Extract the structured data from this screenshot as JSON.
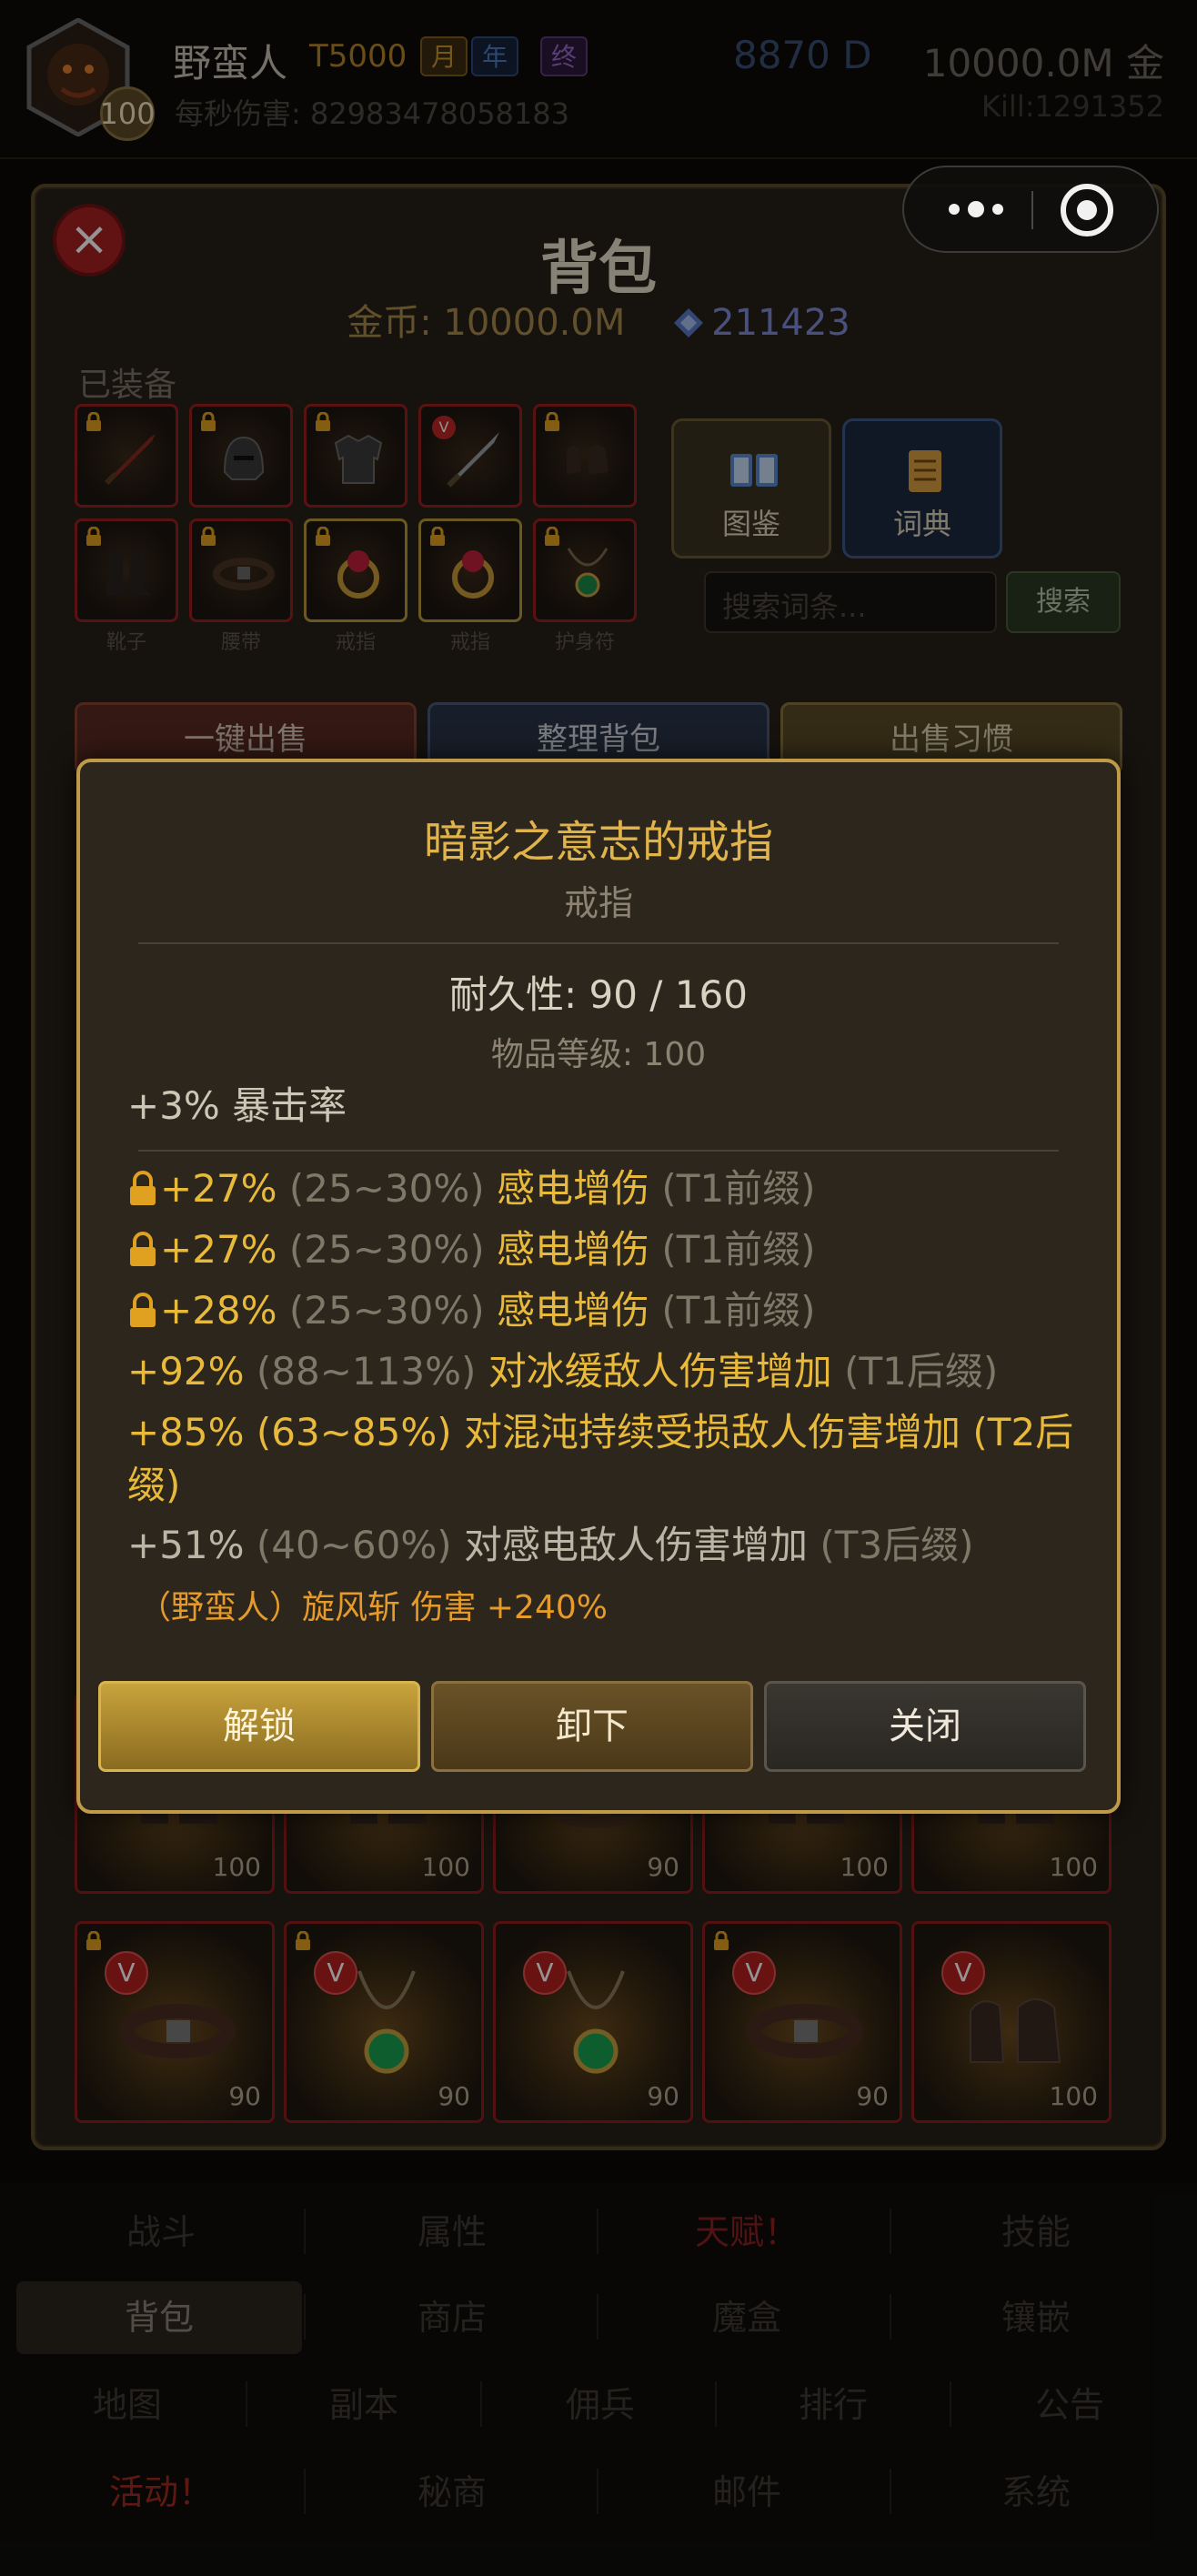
{
  "header": {
    "avatar_level": "100",
    "player_name": "野蛮人",
    "tier": "T5000",
    "badges": [
      "月",
      "年",
      "终"
    ],
    "dps_label": "每秒伤害: 82983478058183",
    "diamond": "8870 D",
    "gold": "10000.0M 金",
    "kills": "Kill:1291352"
  },
  "bag": {
    "title": "背包",
    "gold_text": "金币: 10000.0M",
    "gem_text": "211423",
    "equipped_label": "已装备",
    "equipped_captions": [
      "靴子",
      "腰带",
      "戒指",
      "戒指",
      "护身符"
    ],
    "codex_label": "图鉴",
    "dictionary_label": "词典",
    "search_placeholder": "搜索词条...",
    "search_button": "搜索",
    "actions": [
      "一键出售",
      "整理背包",
      "出售习惯"
    ]
  },
  "inventory": {
    "row1_levels": [
      "100",
      "100",
      "90",
      "100",
      "100"
    ],
    "row2": [
      {
        "item": "belt",
        "level": "90",
        "locked": true,
        "v": "V"
      },
      {
        "item": "amulet",
        "level": "90",
        "locked": true,
        "v": "V"
      },
      {
        "item": "amulet",
        "level": "90",
        "locked": false,
        "v": "V"
      },
      {
        "item": "belt",
        "level": "90",
        "locked": true,
        "v": "V"
      },
      {
        "item": "gloves",
        "level": "100",
        "locked": false,
        "v": "V"
      }
    ]
  },
  "modal": {
    "title": "暗影之意志的戒指",
    "type": "戒指",
    "durability": "耐久性: 90 / 160",
    "item_level": "物品等级: 100",
    "implicit": "+3% 暴击率",
    "affixes": [
      {
        "locked": true,
        "value": "+27%",
        "range": "(25~30%)",
        "name": "感电增伤",
        "tier": "(T1前缀)"
      },
      {
        "locked": true,
        "value": "+27%",
        "range": "(25~30%)",
        "name": "感电增伤",
        "tier": "(T1前缀)"
      },
      {
        "locked": true,
        "value": "+28%",
        "range": "(25~30%)",
        "name": "感电增伤",
        "tier": "(T1前缀)"
      },
      {
        "locked": false,
        "value": "+92%",
        "range": "(88~113%)",
        "name": "对冰缓敌人伤害增加",
        "tier": "(T1后缀)"
      },
      {
        "locked": false,
        "value": "+85%",
        "range": "(63~85%)",
        "name": "对混沌持续受损敌人伤害增加",
        "tier": "(T2后缀)"
      },
      {
        "locked": false,
        "value": "+51%",
        "range": "(40~60%)",
        "name": "对感电敌人伤害增加",
        "tier": "(T3后缀)"
      }
    ],
    "skill_bonus": "（野蛮人）旋风斩 伤害 +240%",
    "buttons": {
      "unlock": "解锁",
      "unequip": "卸下",
      "close": "关闭"
    }
  },
  "bottom_nav": [
    [
      "战斗",
      "属性",
      "天赋！",
      "技能"
    ],
    [
      "背包",
      "商店",
      "魔盒",
      "镶嵌"
    ],
    [
      "地图",
      "副本",
      "佣兵",
      "排行",
      "公告"
    ],
    [
      "活动！",
      "秘商",
      "邮件",
      "系统"
    ]
  ],
  "colors": {
    "modal_border": "#bf9a48",
    "title_gold": "#e0b44a",
    "affix_gold": "#e9ba3a",
    "item_border_red": "#8e1d1d",
    "alert_red": "#a02a20"
  }
}
